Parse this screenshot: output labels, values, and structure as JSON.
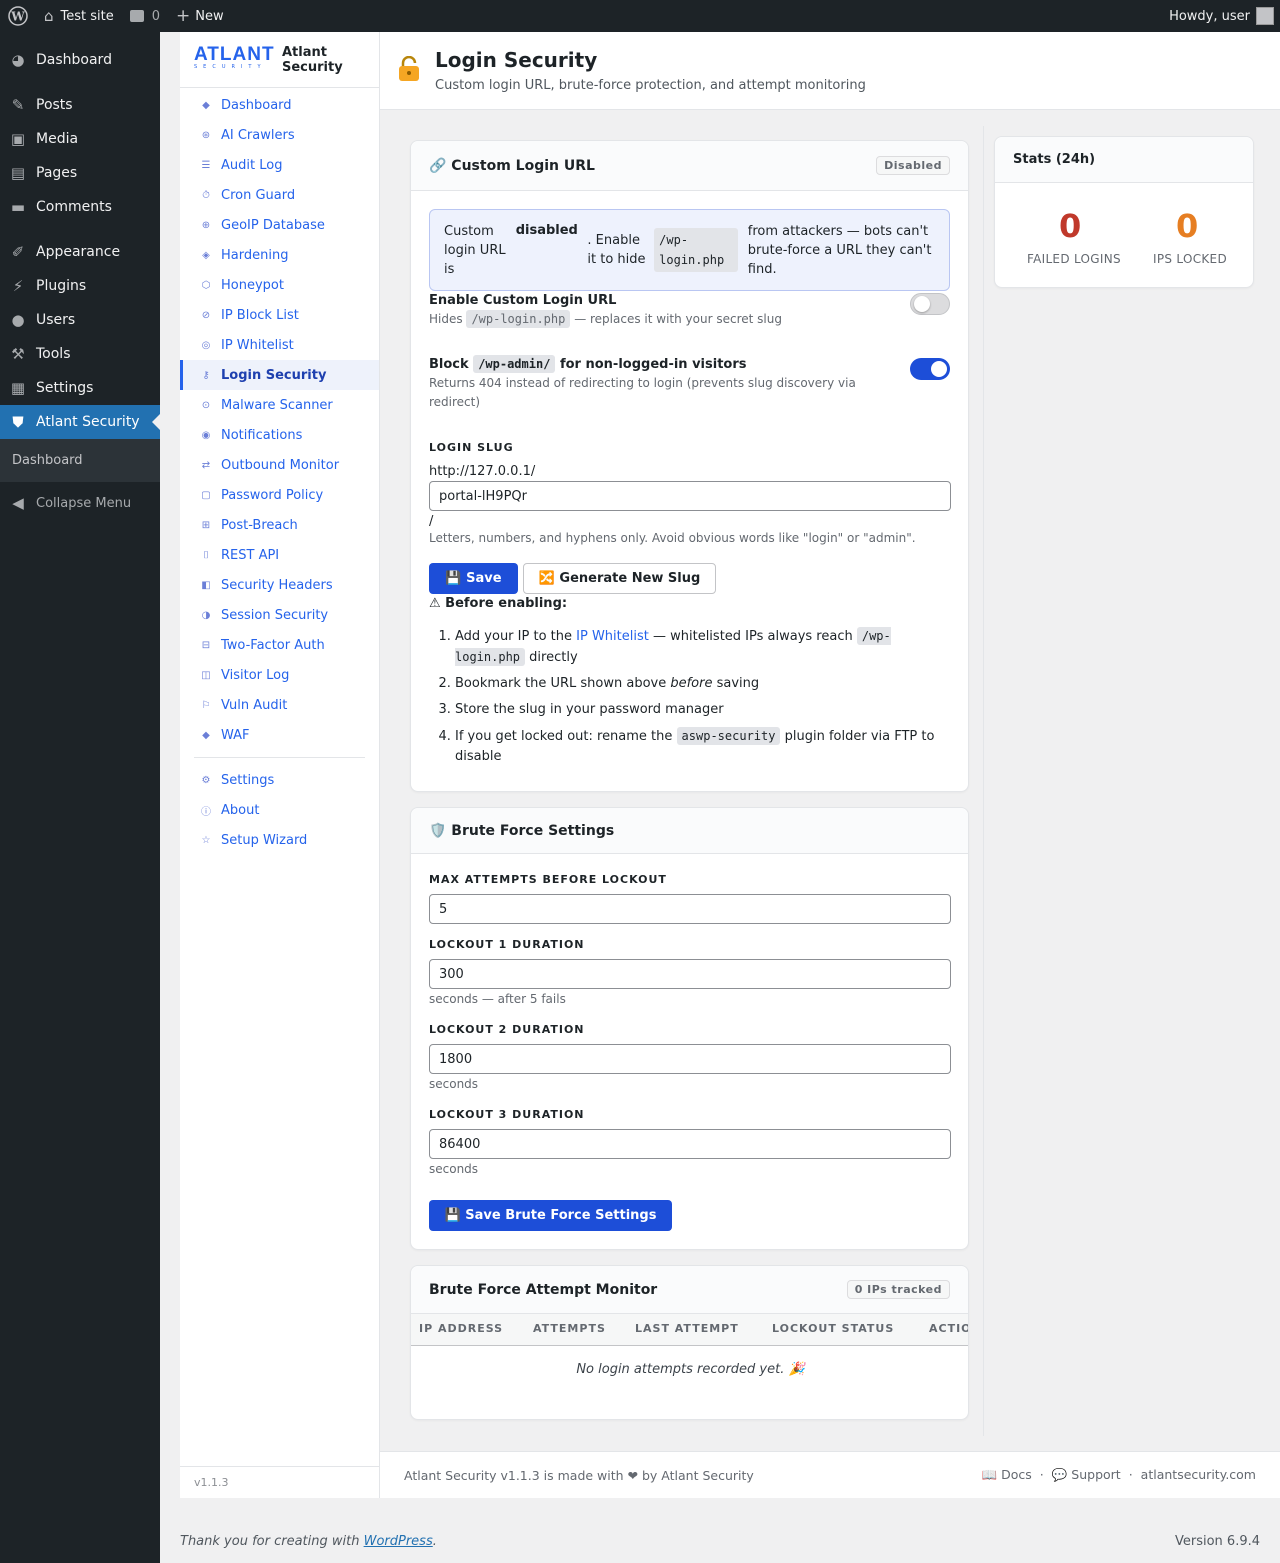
{
  "adminbar": {
    "site": "Test site",
    "comments": "0",
    "new": "New",
    "howdy": "Howdy, user"
  },
  "wpmenu": {
    "items": [
      "Dashboard",
      "Posts",
      "Media",
      "Pages",
      "Comments",
      "Appearance",
      "Plugins",
      "Users",
      "Tools",
      "Settings",
      "Atlant Security"
    ],
    "sub": "Dashboard",
    "collapse": "Collapse Menu"
  },
  "plugin": {
    "name_line1": "Atlant",
    "name_line2": "Security",
    "logo_text": "ATLANT",
    "logo_sub": "SECURITY",
    "nav": [
      "Dashboard",
      "AI Crawlers",
      "Audit Log",
      "Cron Guard",
      "GeoIP Database",
      "Hardening",
      "Honeypot",
      "IP Block List",
      "IP Whitelist",
      "Login Security",
      "Malware Scanner",
      "Notifications",
      "Outbound Monitor",
      "Password Policy",
      "Post-Breach",
      "REST API",
      "Security Headers",
      "Session Security",
      "Two-Factor Auth",
      "Visitor Log",
      "Vuln Audit",
      "WAF"
    ],
    "nav_bottom": [
      "Settings",
      "About",
      "Setup Wizard"
    ],
    "version": "v1.1.3"
  },
  "header": {
    "title": "Login Security",
    "subtitle": "Custom login URL, brute-force protection, and attempt monitoring"
  },
  "custom_login": {
    "title": "🔗 Custom Login URL",
    "badge": "Disabled",
    "notice": {
      "a": "Custom login URL is",
      "b": "disabled",
      "c": ". Enable it to hide",
      "code": "/wp-login.php",
      "d": "from attackers — bots can't brute-force a URL they can't find."
    },
    "enable_title": "Enable Custom Login URL",
    "enable_desc_a": "Hides",
    "enable_desc_code": "/wp-login.php",
    "enable_desc_b": "— replaces it with your secret slug",
    "enable_on": false,
    "block_title_a": "Block",
    "block_title_code": "/wp-admin/",
    "block_title_b": "for non-logged-in visitors",
    "block_desc": "Returns 404 instead of redirecting to login (prevents slug discovery via redirect)",
    "block_on": true,
    "slug_label": "LOGIN SLUG",
    "slug_prefix": "http://127.0.0.1/",
    "slug_value": "portal-lH9PQr",
    "slug_suffix": "/",
    "slug_hint": "Letters, numbers, and hyphens only. Avoid obvious words like \"login\" or \"admin\".",
    "save": "💾 Save",
    "generate": "🔀 Generate New Slug",
    "before": "⚠ Before enabling:",
    "step1_a": "Add your IP to the",
    "step1_link": "IP Whitelist",
    "step1_b": "— whitelisted IPs always reach",
    "step1_code": "/wp-login.php",
    "step1_c": "directly",
    "step2_a": "Bookmark the URL shown above",
    "step2_em": "before",
    "step2_b": "saving",
    "step3": "Store the slug in your password manager",
    "step4_a": "If you get locked out: rename the",
    "step4_code": "aswp-security",
    "step4_b": "plugin folder via FTP to disable"
  },
  "brute": {
    "title": "🛡️ Brute Force Settings",
    "max_label": "MAX ATTEMPTS BEFORE LOCKOUT",
    "max_value": "5",
    "l1_label": "LOCKOUT 1 DURATION",
    "l1_value": "300",
    "l1_hint": "seconds — after 5 fails",
    "l2_label": "LOCKOUT 2 DURATION",
    "l2_value": "1800",
    "l2_hint": "seconds",
    "l3_label": "LOCKOUT 3 DURATION",
    "l3_value": "86400",
    "l3_hint": "seconds",
    "save": "💾 Save Brute Force Settings"
  },
  "monitor": {
    "title": "Brute Force Attempt Monitor",
    "badge": "0 IPs tracked",
    "columns": [
      "IP ADDRESS",
      "ATTEMPTS",
      "LAST ATTEMPT",
      "LOCKOUT STATUS",
      "ACTIO"
    ],
    "empty": "No login attempts recorded yet. 🎉"
  },
  "stats": {
    "title": "Stats (24h)",
    "failed": "0",
    "failed_label": "FAILED LOGINS",
    "locked": "0",
    "locked_label": "IPS LOCKED"
  },
  "footer": {
    "left": "Atlant Security v1.1.3 is made with ❤ by Atlant Security",
    "docs": "📖 Docs",
    "support": "💬 Support",
    "site": "atlantsecurity.com",
    "dot": "·"
  },
  "wpfooter": {
    "thanks_a": "Thank you for creating with",
    "thanks_link": "WordPress",
    "thanks_b": ".",
    "version": "Version 6.9.4"
  },
  "colors": {
    "accent": "#1d4ed8",
    "failed": "#c0392b",
    "locked": "#e67e22",
    "toggle_off": "#dcdcde",
    "wp_highlight": "#2271b1"
  }
}
